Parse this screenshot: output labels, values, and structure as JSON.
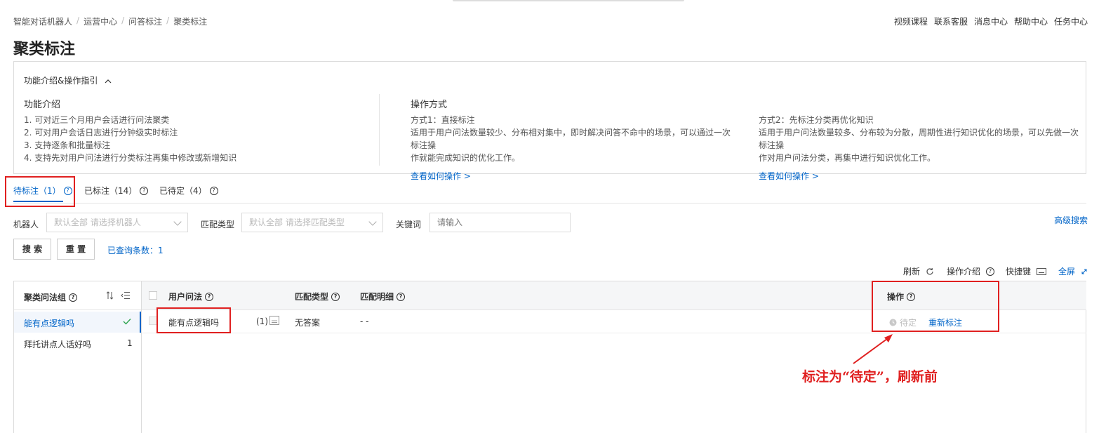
{
  "breadcrumb": [
    "智能对话机器人",
    "运营中心",
    "问答标注",
    "聚类标注"
  ],
  "top_links": [
    "视频课程",
    "联系客服",
    "消息中心",
    "帮助中心",
    "任务中心"
  ],
  "page_title": "聚类标注",
  "intro": {
    "toggle_label": "功能介绍&操作指引",
    "feature_title": "功能介绍",
    "feature_lines": [
      "1. 可对近三个月用户会话进行问法聚类",
      "2. 可对用户会话日志进行分钟级实时标注",
      "3. 支持逐条和批量标注",
      "4. 支持先对用户问法进行分类标注再集中修改或新增知识"
    ],
    "operation_title": "操作方式",
    "mode1": {
      "title": "方式1：直接标注",
      "line1": "适用于用户问法数量较少、分布相对集中，即时解决问答不命中的场景，可以通过一次标注操",
      "line2": "作就能完成知识的优化工作。",
      "link": "查看如何操作 >"
    },
    "mode2": {
      "title": "方式2：先标注分类再优化知识",
      "line1": "适用于用户问法数量较多、分布较为分散，周期性进行知识优化的场景，可以先做一次标注操",
      "line2": "作对用户问法分类，再集中进行知识优化工作。",
      "link": "查看如何操作 >"
    }
  },
  "tabs": [
    {
      "label": "待标注（1）",
      "active": true
    },
    {
      "label": "已标注（14）",
      "active": false
    },
    {
      "label": "已待定（4）",
      "active": false
    }
  ],
  "filters": {
    "robot_label": "机器人",
    "robot_placeholder": "默认全部 请选择机器人",
    "match_label": "匹配类型",
    "match_placeholder": "默认全部 请选择匹配类型",
    "keyword_label": "关键词",
    "keyword_placeholder": "请输入",
    "advanced": "高级搜索",
    "search_btn": "搜 索",
    "reset_btn": "重 置",
    "result_count": "已查询条数：1"
  },
  "toolbar": {
    "refresh": "刷新",
    "op_intro": "操作介绍",
    "shortcut": "快捷键",
    "fullscreen": "全屏"
  },
  "groups": {
    "header": "聚类问法组",
    "items": [
      {
        "label": "能有点逻辑吗",
        "active": true,
        "count": ""
      },
      {
        "label": "拜托讲点人话好吗",
        "active": false,
        "count": "1"
      }
    ]
  },
  "table": {
    "columns": {
      "question": "用户问法",
      "match_type": "匹配类型",
      "match_detail": "匹配明细",
      "action": "操作"
    },
    "rows": [
      {
        "question": "能有点逻辑吗",
        "count": "(1)",
        "match_type": "无答案",
        "match_detail": "- -",
        "pending": "待定",
        "relabel": "重新标注"
      }
    ]
  },
  "annotation": "标注为“待定”，刷新前",
  "colors": {
    "accent": "#0064c8",
    "annotation_red": "#e02020"
  }
}
